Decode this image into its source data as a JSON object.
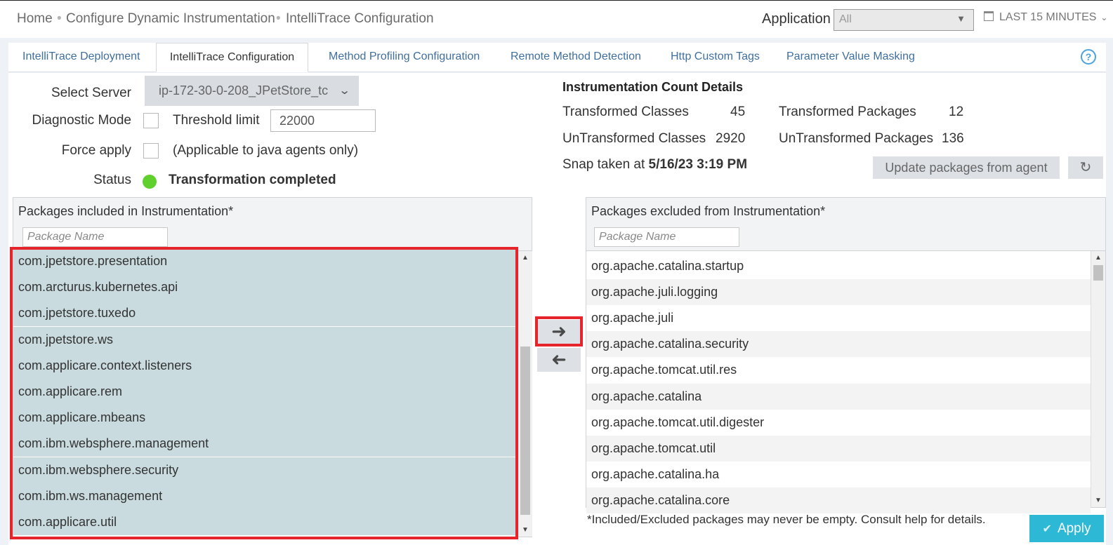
{
  "breadcrumb": {
    "items": [
      "Home",
      "Configure Dynamic Instrumentation",
      "IntelliTrace Configuration"
    ],
    "separator": "•"
  },
  "header": {
    "application_label": "Application",
    "application_value": "All",
    "time_range": "LAST 15 MINUTES"
  },
  "tabs": [
    {
      "label": "IntelliTrace Deployment",
      "active": false
    },
    {
      "label": "IntelliTrace Configuration",
      "active": true
    },
    {
      "label": "Method Profiling Configuration",
      "active": false
    },
    {
      "label": "Remote Method Detection",
      "active": false
    },
    {
      "label": "Http Custom Tags",
      "active": false
    },
    {
      "label": "Parameter Value Masking",
      "active": false
    }
  ],
  "help_label": "?",
  "form": {
    "select_server_label": "Select Server",
    "select_server_value": "ip-172-30-0-208_JPetStore_tc",
    "diagnostic_mode_label": "Diagnostic Mode",
    "threshold_label": "Threshold limit",
    "threshold_value": "22000",
    "force_apply_label": "Force apply",
    "force_apply_note": "(Applicable to java agents only)",
    "status_label": "Status",
    "status_text": "Transformation completed"
  },
  "counts": {
    "title": "Instrumentation Count Details",
    "transformed_classes_label": "Transformed Classes",
    "transformed_classes": "45",
    "transformed_packages_label": "Transformed Packages",
    "transformed_packages": "12",
    "untransformed_classes_label": "UnTransformed Classes",
    "untransformed_classes": "2920",
    "untransformed_packages_label": "UnTransformed Packages",
    "untransformed_packages": "136",
    "snap_label": "Snap taken at",
    "snap_value": "5/16/23 3:19 PM",
    "update_button": "Update packages from agent"
  },
  "included": {
    "title": "Packages included in Instrumentation*",
    "filter_placeholder": "Package Name",
    "packages": [
      "com.jpetstore.presentation",
      "com.arcturus.kubernetes.api",
      "com.jpetstore.tuxedo",
      "com.jpetstore.ws",
      "com.applicare.context.listeners",
      "com.applicare.rem",
      "com.applicare.mbeans",
      "com.ibm.websphere.management",
      "com.ibm.websphere.security",
      "com.ibm.ws.management",
      "com.applicare.util"
    ],
    "row_color": "#c9dbdf"
  },
  "excluded": {
    "title": "Packages excluded from Instrumentation*",
    "filter_placeholder": "Package Name",
    "packages": [
      "org.apache.catalina.startup",
      "org.apache.juli.logging",
      "org.apache.juli",
      "org.apache.catalina.security",
      "org.apache.tomcat.util.res",
      "org.apache.catalina",
      "org.apache.tomcat.util.digester",
      "org.apache.tomcat.util",
      "org.apache.catalina.ha",
      "org.apache.catalina.core"
    ],
    "row_colors": [
      "#ffffff",
      "#f3f3f3"
    ]
  },
  "move_right_icon": "arrow-right-icon",
  "move_left_icon": "arrow-left-icon",
  "footnote": "*Included/Excluded packages may never be empty. Consult help for details.",
  "apply_button": "Apply",
  "colors": {
    "accent": "#2db8d6",
    "highlight": "#e5252b",
    "status_ok": "#5fd02d",
    "tab_link": "#3f6f9e"
  }
}
